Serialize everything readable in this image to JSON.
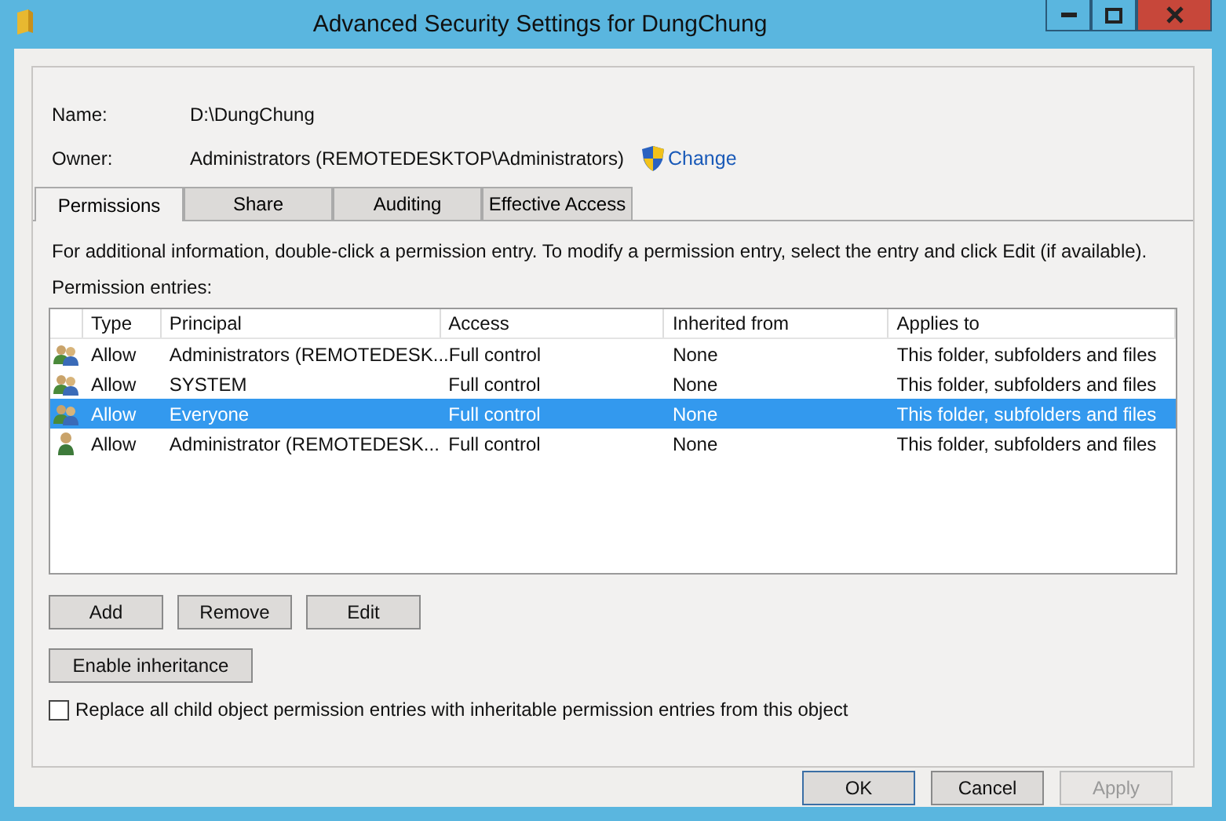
{
  "window": {
    "title": "Advanced Security Settings for DungChung"
  },
  "name": {
    "label": "Name:",
    "value": "D:\\DungChung"
  },
  "owner": {
    "label": "Owner:",
    "value": "Administrators (REMOTEDESKTOP\\Administrators)",
    "link": "Change"
  },
  "tabs": [
    {
      "label": "Permissions",
      "selected": true
    },
    {
      "label": "Share",
      "selected": false
    },
    {
      "label": "Auditing",
      "selected": false
    },
    {
      "label": "Effective Access",
      "selected": false
    }
  ],
  "info": "For additional information, double-click a permission entry. To modify a permission entry, select the entry and click Edit (if available).",
  "entries_label": "Permission entries:",
  "table": {
    "columns": [
      "Type",
      "Principal",
      "Access",
      "Inherited from",
      "Applies to"
    ],
    "rows": [
      {
        "kind": "group",
        "selected": false,
        "cells": [
          "Allow",
          "Administrators (REMOTEDESK...",
          "Full control",
          "None",
          "This folder, subfolders and files"
        ]
      },
      {
        "kind": "group",
        "selected": false,
        "cells": [
          "Allow",
          "SYSTEM",
          "Full control",
          "None",
          "This folder, subfolders and files"
        ]
      },
      {
        "kind": "group",
        "selected": true,
        "cells": [
          "Allow",
          "Everyone",
          "Full control",
          "None",
          "This folder, subfolders and files"
        ]
      },
      {
        "kind": "user",
        "selected": false,
        "cells": [
          "Allow",
          "Administrator (REMOTEDESK...",
          "Full control",
          "None",
          "This folder, subfolders and files"
        ]
      }
    ]
  },
  "entry_buttons": [
    "Add",
    "Remove",
    "Edit"
  ],
  "inheritance_button": "Enable inheritance",
  "replace_option": {
    "label": "Replace all child object permission entries with inheritable permission entries from this object",
    "checked": false
  },
  "dialog_buttons": [
    {
      "label": "OK",
      "disabled": false,
      "default": true
    },
    {
      "label": "Cancel",
      "disabled": false,
      "default": false
    },
    {
      "label": "Apply",
      "disabled": true,
      "default": false
    }
  ]
}
